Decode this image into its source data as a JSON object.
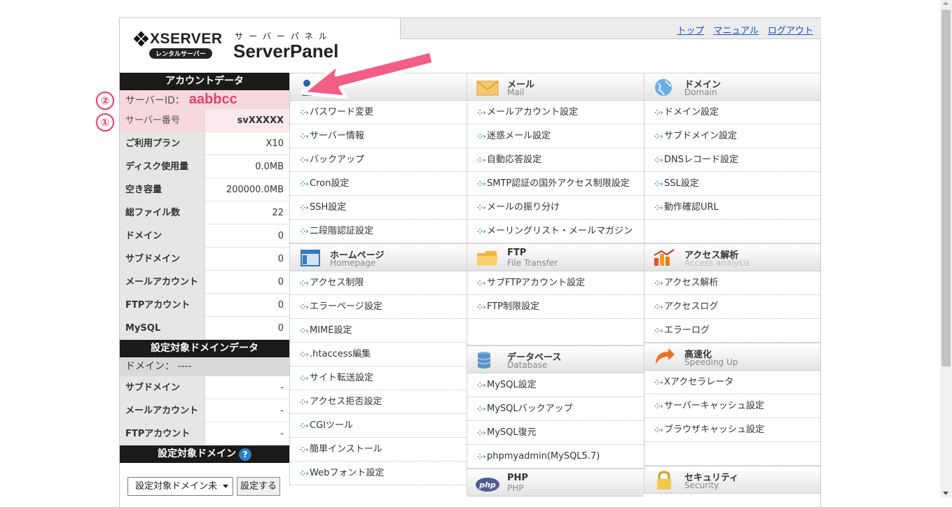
{
  "header": {
    "brand": "XSERVER",
    "brand_sub": "レンタルサーバー",
    "panel_kana": "サーバーパネル",
    "panel_title": "ServerPanel"
  },
  "topnav": {
    "top": "トップ",
    "manual": "マニュアル",
    "logout": "ログアウト"
  },
  "account": {
    "title": "アカウントデータ",
    "server_id_label": "サーバーID：",
    "server_id_value": "aabbcc",
    "rows": [
      {
        "label": "サーバー番号",
        "value": "svXXXXX"
      },
      {
        "label": "ご利用プラン",
        "value": "X10"
      },
      {
        "label": "ディスク使用量",
        "value": "0.0MB"
      },
      {
        "label": "空き容量",
        "value": "200000.0MB"
      },
      {
        "label": "総ファイル数",
        "value": "22"
      },
      {
        "label": "ドメイン",
        "value": "0"
      },
      {
        "label": "サブドメイン",
        "value": "0"
      },
      {
        "label": "メールアカウント",
        "value": "0"
      },
      {
        "label": "FTPアカウント",
        "value": "0"
      },
      {
        "label": "MySQL",
        "value": "0"
      }
    ]
  },
  "domain_data": {
    "title": "設定対象ドメインデータ",
    "domain_label": "ドメイン： ----",
    "rows": [
      {
        "label": "サブドメイン",
        "value": "-"
      },
      {
        "label": "メールアカウント",
        "value": "-"
      },
      {
        "label": "FTPアカウント",
        "value": "-"
      }
    ]
  },
  "domain_select": {
    "title": "設定対象ドメイン",
    "help": "?",
    "select_value": "設定対象ドメイン未",
    "submit": "設定する"
  },
  "badges": {
    "one": "①",
    "two": "②"
  },
  "menu": {
    "account_items": [
      "パスワード変更",
      "サーバー情報",
      "バックアップ",
      "Cron設定",
      "SSH設定",
      "二段階認証設定"
    ],
    "mail": {
      "title": "メール",
      "sub": "Mail",
      "items": [
        "メールアカウント設定",
        "迷惑メール設定",
        "自動応答設定",
        "SMTP認証の国外アクセス制限設定",
        "メールの振り分け",
        "メーリングリスト・メールマガジン"
      ]
    },
    "domain": {
      "title": "ドメイン",
      "sub": "Domain",
      "items": [
        "ドメイン設定",
        "サブドメイン設定",
        "DNSレコード設定",
        "SSL設定",
        "動作確認URL"
      ]
    },
    "homepage": {
      "title": "ホームページ",
      "sub": "Homepage",
      "items": [
        "アクセス制限",
        "エラーページ設定",
        "MIME設定",
        ".htaccess編集",
        "サイト転送設定",
        "アクセス拒否設定",
        "CGIツール",
        "簡単インストール",
        "Webフォント設定"
      ]
    },
    "ftp": {
      "title": "FTP",
      "sub": "File Transfer",
      "items": [
        "サブFTPアカウント設定",
        "FTP制限設定"
      ]
    },
    "access": {
      "title": "アクセス解析",
      "sub": "Access analysis",
      "items": [
        "アクセス解析",
        "アクセスログ",
        "エラーログ"
      ]
    },
    "database": {
      "title": "データベース",
      "sub": "Database",
      "items": [
        "MySQL設定",
        "MySQLバックアップ",
        "MySQL復元",
        "phpmyadmin(MySQL5.7)"
      ]
    },
    "speed": {
      "title": "高速化",
      "sub": "Speeding Up",
      "items": [
        "Xアクセラレータ",
        "サーバーキャッシュ設定",
        "ブラウザキャッシュ設定"
      ]
    },
    "php": {
      "title": "PHP",
      "sub": "PHP"
    },
    "security": {
      "title": "セキュリティ",
      "sub": "Security"
    }
  }
}
